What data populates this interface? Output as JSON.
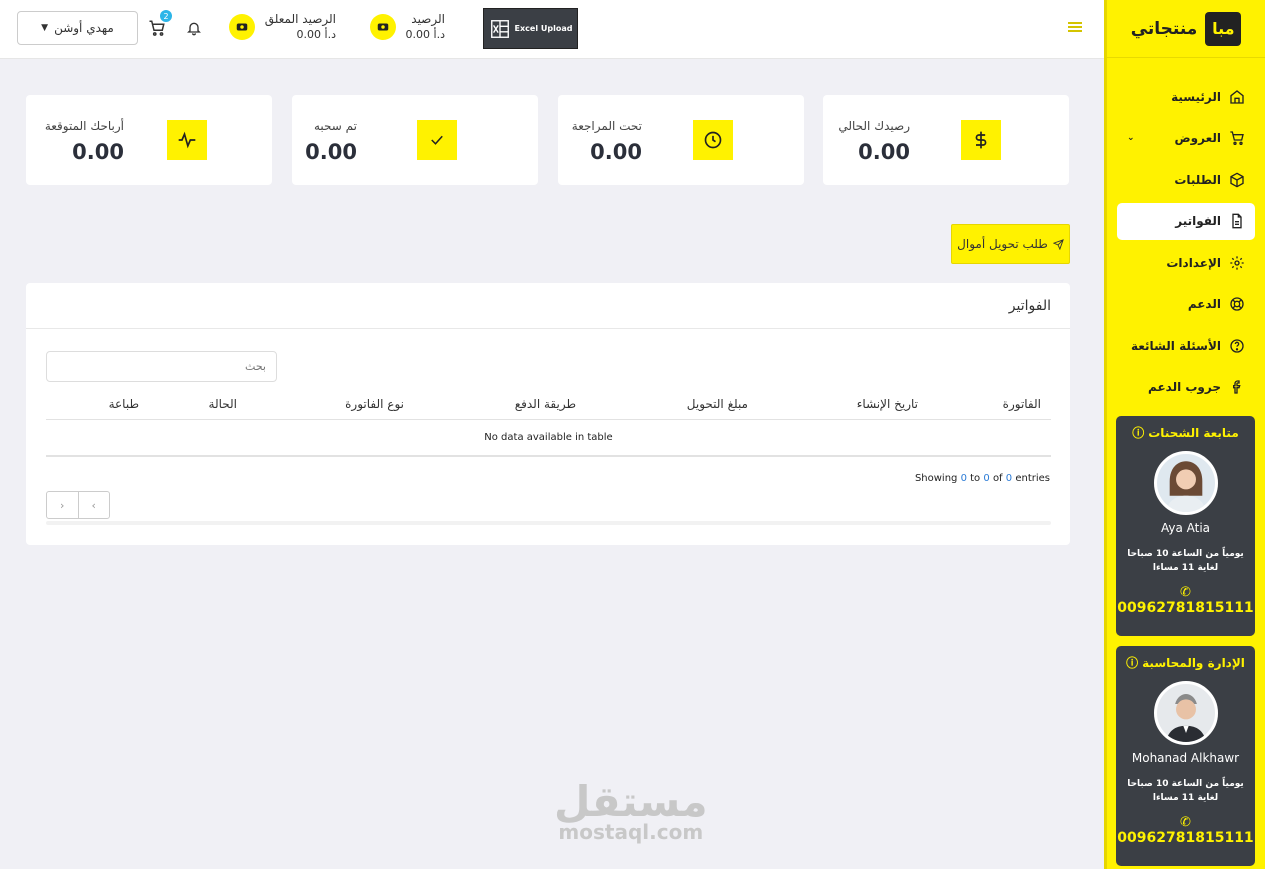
{
  "brand": {
    "logo_text": "مبا",
    "name": "منتجاتي"
  },
  "sidebar": {
    "items": [
      {
        "label": "الرئيسية"
      },
      {
        "label": "العروض"
      },
      {
        "label": "الطلبات"
      },
      {
        "label": "الفواتير"
      },
      {
        "label": "الإعدادات"
      },
      {
        "label": "الدعم"
      },
      {
        "label": "الأسئلة الشائعة"
      },
      {
        "label": "جروب الدعم"
      }
    ],
    "cards": [
      {
        "title": "متابعة الشحنات",
        "name": "Aya Atia",
        "hours_line1": "يومياً من الساعة 10 صباحا",
        "hours_line2": "لغاية 11 مساءا",
        "phone": "00962781815111"
      },
      {
        "title": "الإدارة والمحاسبة",
        "name": "Mohanad Alkhawr",
        "hours_line1": "يومياً من الساعة 10 صباحا",
        "hours_line2": "لغاية 11 مساءا",
        "phone": "00962781815111"
      }
    ]
  },
  "header": {
    "excel_label": "Excel Upload",
    "balance_label": "الرصيد",
    "balance_value": "د.أ 0.00",
    "pending_label": "الرصيد المعلق",
    "pending_value": "د.أ 0.00",
    "cart_count": "2",
    "user_name": "مهدي أوشن"
  },
  "stats": [
    {
      "label": "رصيدك الحالي",
      "value": "0.00"
    },
    {
      "label": "تحت المراجعة",
      "value": "0.00"
    },
    {
      "label": "تم سحبه",
      "value": "0.00"
    },
    {
      "label": "أرباحك المتوقعة",
      "value": "0.00"
    }
  ],
  "transfer_button": "طلب تحويل أموال",
  "invoices": {
    "title": "الفواتير",
    "search_placeholder": "بحث",
    "columns": [
      "الفاتورة",
      "تاريخ الإنشاء",
      "مبلغ التحويل",
      "طريقة الدفع",
      "نوع الفاتورة",
      "الحالة",
      "طباعة"
    ],
    "empty_text": "No data available in table",
    "showing_prefix": "Showing",
    "showing_from": "0",
    "showing_to_word": "to",
    "showing_to": "0",
    "showing_of_word": "of",
    "showing_total": "0",
    "showing_suffix": "entries",
    "pager_prev": "‹",
    "pager_next": "›"
  },
  "watermark": {
    "arabic": "مستقل",
    "latin": "mostaql.com"
  },
  "colors": {
    "accent": "#fff200",
    "dark": "#3b3f45",
    "link": "#2b7bd6"
  }
}
